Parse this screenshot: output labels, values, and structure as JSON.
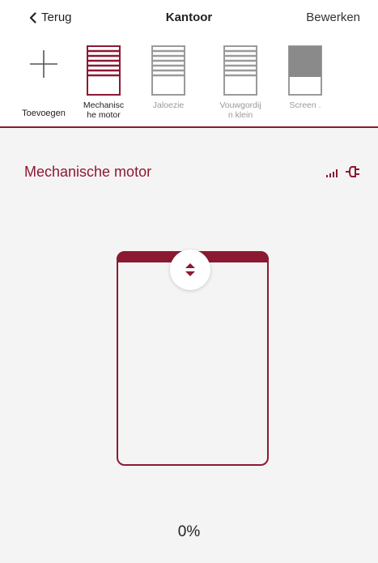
{
  "nav": {
    "back_label": "Terug",
    "title": "Kantoor",
    "edit_label": "Bewerken"
  },
  "devices": [
    {
      "label": "Toevoegen",
      "icon": "plus-icon"
    },
    {
      "label": "Mechanisc\nhe motor",
      "icon": "blind-icon",
      "selected": true
    },
    {
      "label": "Jaloezie",
      "icon": "blind-icon"
    },
    {
      "label": "Vouwgordij\nn  klein",
      "icon": "blind-icon"
    },
    {
      "label": "Screen .",
      "icon": "screen-icon"
    }
  ],
  "panel": {
    "device_name": "Mechanische motor",
    "position_label": "0%"
  },
  "position": 0,
  "colors": {
    "accent": "#8c1932",
    "panel_bg": "#f4f4f4",
    "inactive_icon": "#9a9a9a"
  }
}
